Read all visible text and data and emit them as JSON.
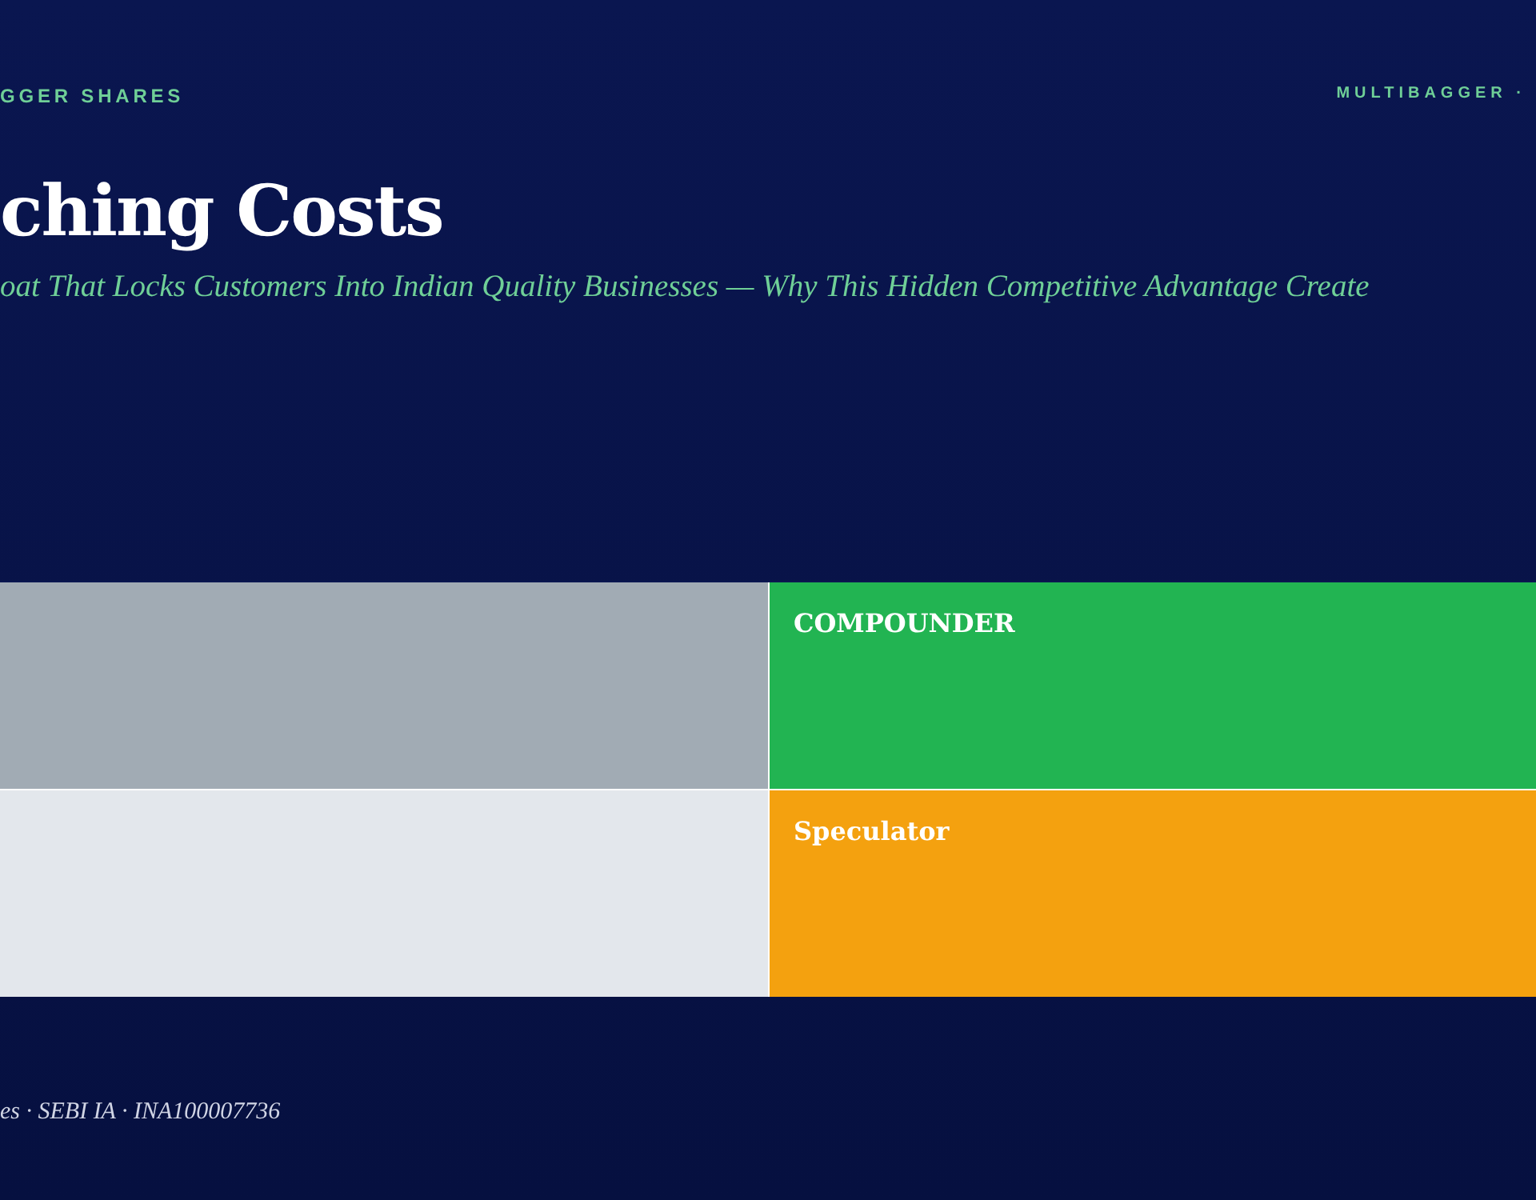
{
  "header": {
    "brand": "GGER SHARES",
    "tag": "MULTIBAGGER ·"
  },
  "title": "ching Costs",
  "subtitle": "oat That Locks Customers Into Indian Quality Businesses — Why This Hidden Competitive Advantage Create",
  "matrix": {
    "quadrants": [
      {
        "color": "#a1abb4"
      },
      {
        "label": "COMPOUNDER",
        "color": "#22b452"
      },
      {
        "color": "#e3e7ec"
      },
      {
        "label": "Speculator",
        "color": "#f4a10f"
      }
    ]
  },
  "footer": "es · SEBI IA · INA100007736"
}
